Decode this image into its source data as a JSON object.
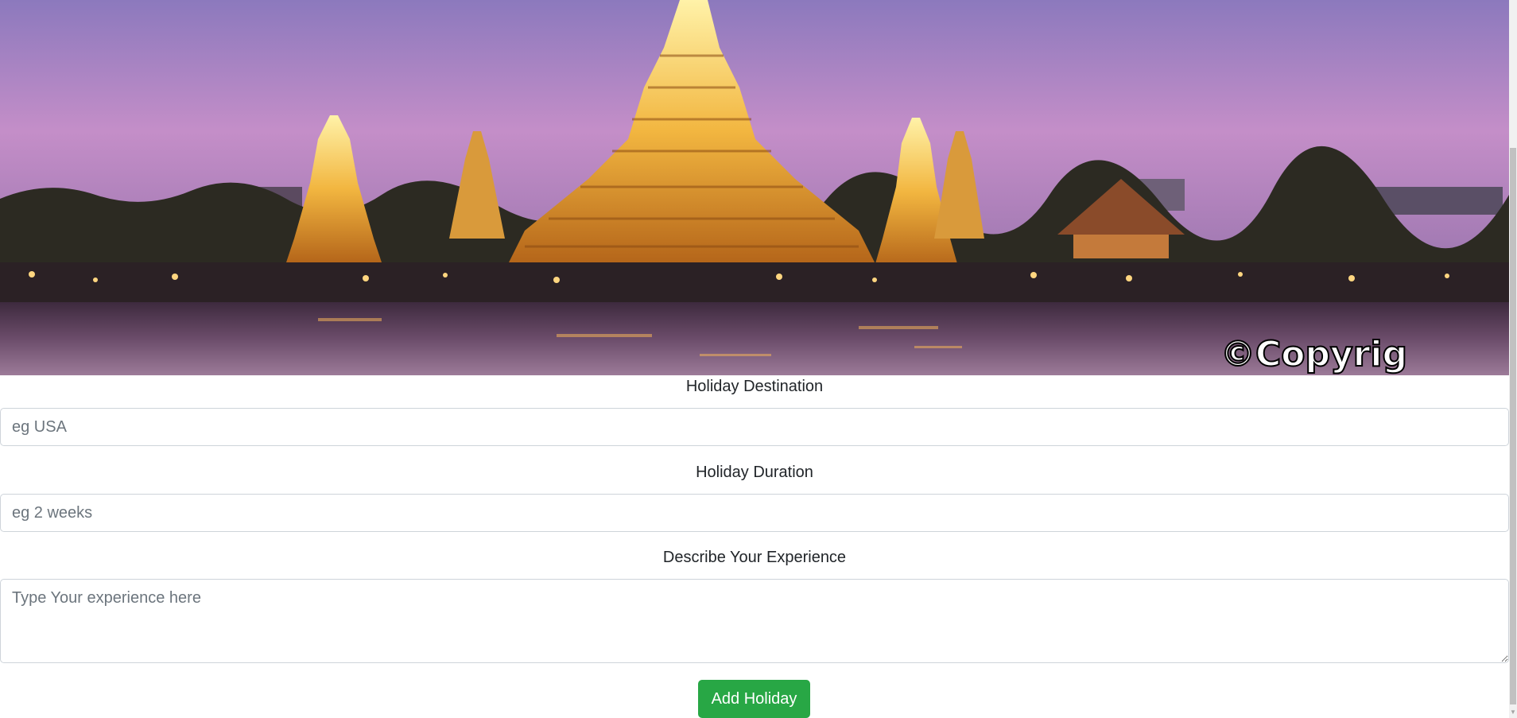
{
  "hero": {
    "watermark": "©Copyrig"
  },
  "form": {
    "destination": {
      "label": "Holiday Destination",
      "placeholder": "eg USA",
      "value": ""
    },
    "duration": {
      "label": "Holiday Duration",
      "placeholder": "eg 2 weeks",
      "value": ""
    },
    "experience": {
      "label": "Describe Your Experience",
      "placeholder": "Type Your experience here",
      "value": ""
    },
    "submit_label": "Add Holiday"
  },
  "colors": {
    "submit_button": "#28a745",
    "input_border": "#ced4da",
    "placeholder": "#6c757d"
  },
  "icons": {
    "scroll_down": "chevron-down-icon",
    "resize_handle": "resize-grip-icon"
  }
}
